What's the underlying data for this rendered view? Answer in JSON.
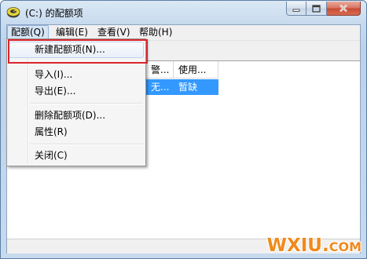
{
  "window": {
    "title": "(C:) 的配额项",
    "icon": "disk-quota-icon",
    "caption_buttons": [
      "minimize-icon",
      "maximize-icon",
      "close-icon"
    ]
  },
  "menubar": {
    "items": [
      {
        "label": "配额(Q)"
      },
      {
        "label": "编辑(E)"
      },
      {
        "label": "查看(V)"
      },
      {
        "label": "帮助(H)"
      }
    ]
  },
  "list": {
    "columns": [
      "警...",
      "使用..."
    ],
    "rows": [
      {
        "cells": [
          "无...",
          "暂缺"
        ]
      }
    ]
  },
  "dropdown": {
    "items": [
      {
        "label": "新建配额项(N)..."
      },
      {
        "label": "导入(I)..."
      },
      {
        "label": "导出(E)..."
      },
      {
        "label": "删除配额项(D)..."
      },
      {
        "label": "属性(R)"
      },
      {
        "label": "关闭(C)"
      }
    ]
  },
  "watermark": {
    "brand": "WXIU",
    "dot": ".",
    "suffix": "COM"
  },
  "colors": {
    "selection": "#3399ff",
    "highlight_box": "#d9262b",
    "watermark": "#f08a1c"
  }
}
